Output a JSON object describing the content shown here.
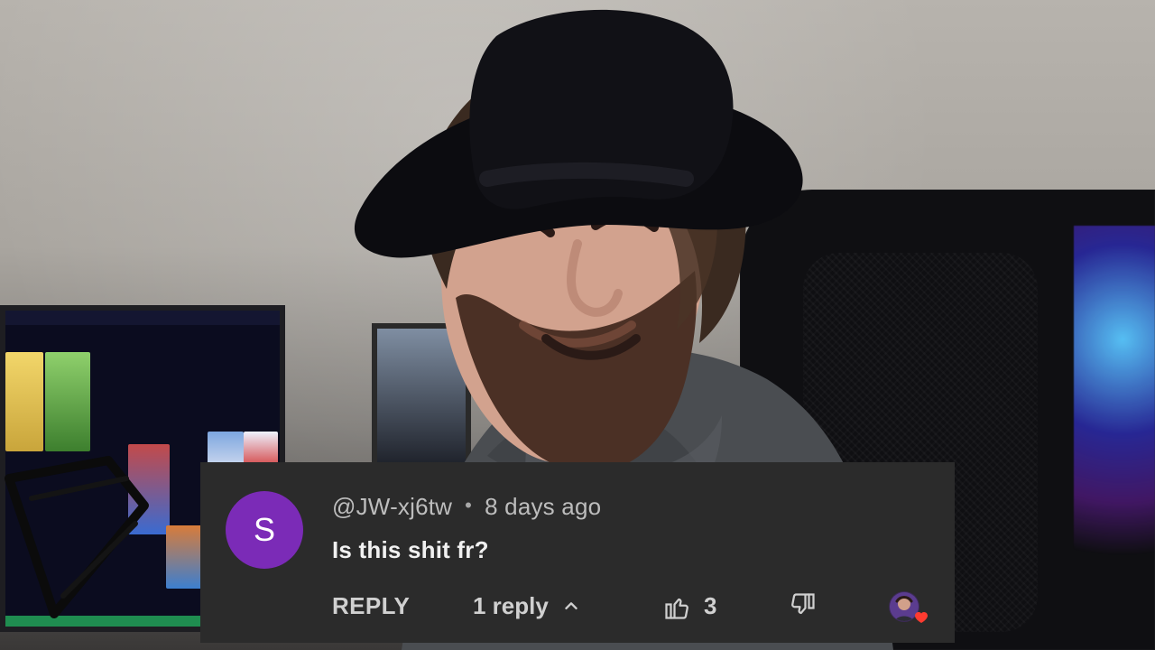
{
  "overlay": {
    "avatar_letter": "S",
    "username": "@JW-xj6tw",
    "separator": "•",
    "time_ago": "8 days ago",
    "comment": "Is this shit fr?",
    "reply_label": "REPLY",
    "replies_count_label": "1 reply",
    "likes_count": "3"
  },
  "colors": {
    "overlay_bg": "#2b2b2b",
    "avatar_bg": "#7b2bb7",
    "heart": "#ff3b30"
  },
  "icons": {
    "chevron": "chevron-up-icon",
    "like": "thumbs-up-icon",
    "dislike": "thumbs-down-icon",
    "creator_heart": "heart-icon"
  }
}
